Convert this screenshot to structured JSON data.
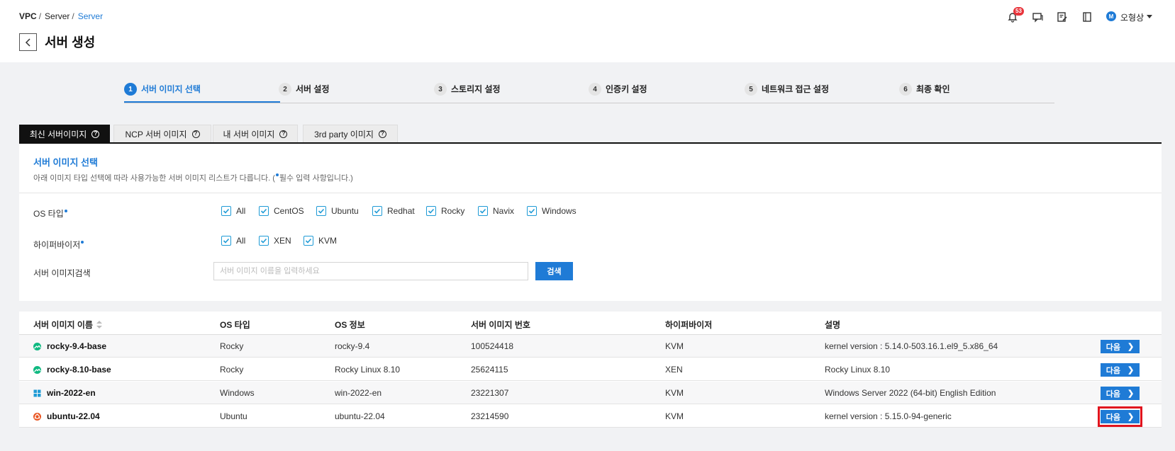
{
  "breadcrumb": {
    "level1": "VPC",
    "level2": "Server",
    "current": "Server"
  },
  "page": {
    "title": "서버 생성"
  },
  "header": {
    "notification_count": "53",
    "user_initial": "M",
    "user_name": "오형상"
  },
  "steps": [
    {
      "num": "1",
      "label": "서버 이미지 선택"
    },
    {
      "num": "2",
      "label": "서버 설정"
    },
    {
      "num": "3",
      "label": "스토리지 설정"
    },
    {
      "num": "4",
      "label": "인증키 설정"
    },
    {
      "num": "5",
      "label": "네트워크 접근 설정"
    },
    {
      "num": "6",
      "label": "최종 확인"
    }
  ],
  "tabs": [
    {
      "label": "최신 서버이미지"
    },
    {
      "label": "NCP 서버 이미지"
    },
    {
      "label": "내 서버 이미지"
    },
    {
      "label": "3rd party 이미지"
    }
  ],
  "help_glyph": "?",
  "panel": {
    "title": "서버 이미지 선택",
    "desc_before": "아래 이미지 타입 선택에 따라 사용가능한 서버 이미지 리스트가 다릅니다. (",
    "desc_after": "필수 입력 사항입니다.)"
  },
  "filters": {
    "os_label": "OS 타입",
    "os_options": [
      "All",
      "CentOS",
      "Ubuntu",
      "Redhat",
      "Rocky",
      "Navix",
      "Windows"
    ],
    "hv_label": "하이퍼바이저",
    "hv_options": [
      "All",
      "XEN",
      "KVM"
    ],
    "search_label": "서버 이미지검색",
    "search_placeholder": "서버 이미지 이름을 입력하세요",
    "search_value": "",
    "search_button": "검색"
  },
  "table": {
    "columns": [
      "서버 이미지 이름",
      "OS 타입",
      "OS 정보",
      "서버 이미지 번호",
      "하이퍼바이저",
      "설명"
    ],
    "next_label": "다음",
    "next_chevron": "❯",
    "rows": [
      {
        "name": "rocky-9.4-base",
        "os_type": "Rocky",
        "os_info": "rocky-9.4",
        "image_no": "100524418",
        "hypervisor": "KVM",
        "description": "kernel version : 5.14.0-503.16.1.el9_5.x86_64",
        "icon": "rocky-icon"
      },
      {
        "name": "rocky-8.10-base",
        "os_type": "Rocky",
        "os_info": "Rocky Linux 8.10",
        "image_no": "25624115",
        "hypervisor": "XEN",
        "description": "Rocky Linux 8.10",
        "icon": "rocky-icon"
      },
      {
        "name": "win-2022-en",
        "os_type": "Windows",
        "os_info": "win-2022-en",
        "image_no": "23221307",
        "hypervisor": "KVM",
        "description": "Windows Server 2022 (64-bit) English Edition",
        "icon": "windows-icon"
      },
      {
        "name": "ubuntu-22.04",
        "os_type": "Ubuntu",
        "os_info": "ubuntu-22.04",
        "image_no": "23214590",
        "hypervisor": "KVM",
        "description": "kernel version : 5.15.0-94-generic",
        "icon": "ubuntu-icon"
      }
    ]
  },
  "colors": {
    "accent": "#1f7bd6",
    "highlight": "#e0141e",
    "badge": "#e8343b"
  }
}
